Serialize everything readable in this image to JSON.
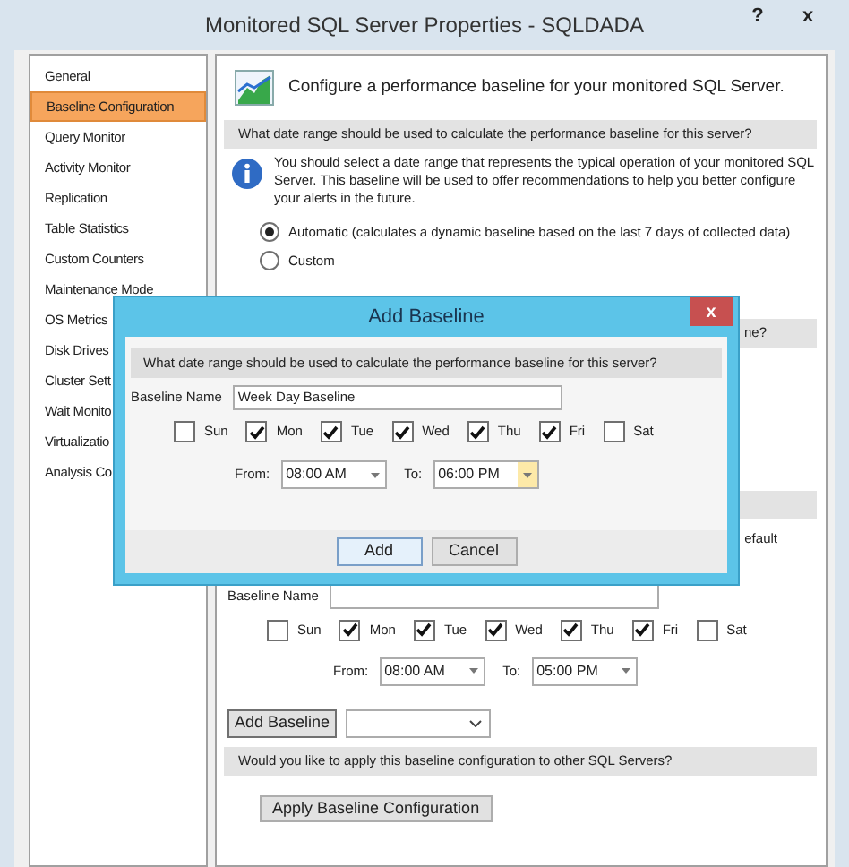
{
  "window": {
    "title": "Monitored SQL Server Properties - SQLDADA",
    "help": "?",
    "close": "x"
  },
  "sidebar": {
    "items": [
      {
        "label": "General",
        "selected": false
      },
      {
        "label": "Baseline Configuration",
        "selected": true
      },
      {
        "label": "Query Monitor",
        "selected": false
      },
      {
        "label": "Activity Monitor",
        "selected": false
      },
      {
        "label": "Replication",
        "selected": false
      },
      {
        "label": "Table Statistics",
        "selected": false
      },
      {
        "label": "Custom Counters",
        "selected": false
      },
      {
        "label": "Maintenance Mode",
        "selected": false
      },
      {
        "label": "OS Metrics",
        "selected": false
      },
      {
        "label": "Disk Drives",
        "selected": false
      },
      {
        "label": "Cluster Sett",
        "selected": false
      },
      {
        "label": "Wait Monito",
        "selected": false
      },
      {
        "label": "Virtualizatio",
        "selected": false
      },
      {
        "label": "Analysis Co",
        "selected": false
      }
    ]
  },
  "main": {
    "heading": "Configure a performance baseline for your monitored SQL Server.",
    "question": "What date range should be used to calculate the performance baseline for this server?",
    "info": "You should select a date range that represents the typical operation of your monitored SQL Server. This baseline will be used to offer recommendations to help you better configure your alerts in the future.",
    "options": [
      {
        "label": "Automatic (calculates a dynamic baseline based on the last 7 days of collected data)",
        "selected": true
      },
      {
        "label": "Custom",
        "selected": false
      }
    ],
    "hidden_question_end": "ne?",
    "hidden_text_end": "efault",
    "baseline_name_label": "Baseline Name",
    "days": [
      {
        "label": "Sun",
        "checked": false
      },
      {
        "label": "Mon",
        "checked": true
      },
      {
        "label": "Tue",
        "checked": true
      },
      {
        "label": "Wed",
        "checked": true
      },
      {
        "label": "Thu",
        "checked": true
      },
      {
        "label": "Fri",
        "checked": true
      },
      {
        "label": "Sat",
        "checked": false
      }
    ],
    "from_label": "From:",
    "from_value": "08:00 AM",
    "to_label": "To:",
    "to_value": "05:00 PM",
    "add_baseline": "Add Baseline",
    "apply_question": "Would you like to apply this baseline configuration to other SQL Servers?",
    "apply_button": "Apply Baseline Configuration"
  },
  "dialog": {
    "title": "Add Baseline",
    "close": "x",
    "question": "What date range should be used to calculate the performance baseline for this server?",
    "baseline_name_label": "Baseline Name",
    "baseline_name": "Week Day Baseline",
    "days": [
      {
        "label": "Sun",
        "checked": false
      },
      {
        "label": "Mon",
        "checked": true
      },
      {
        "label": "Tue",
        "checked": true
      },
      {
        "label": "Wed",
        "checked": true
      },
      {
        "label": "Thu",
        "checked": true
      },
      {
        "label": "Fri",
        "checked": true
      },
      {
        "label": "Sat",
        "checked": false
      }
    ],
    "from_label": "From:",
    "from_value": "08:00 AM",
    "to_label": "To:",
    "to_value": "06:00 PM",
    "buttons": [
      "Add",
      "Cancel"
    ]
  }
}
